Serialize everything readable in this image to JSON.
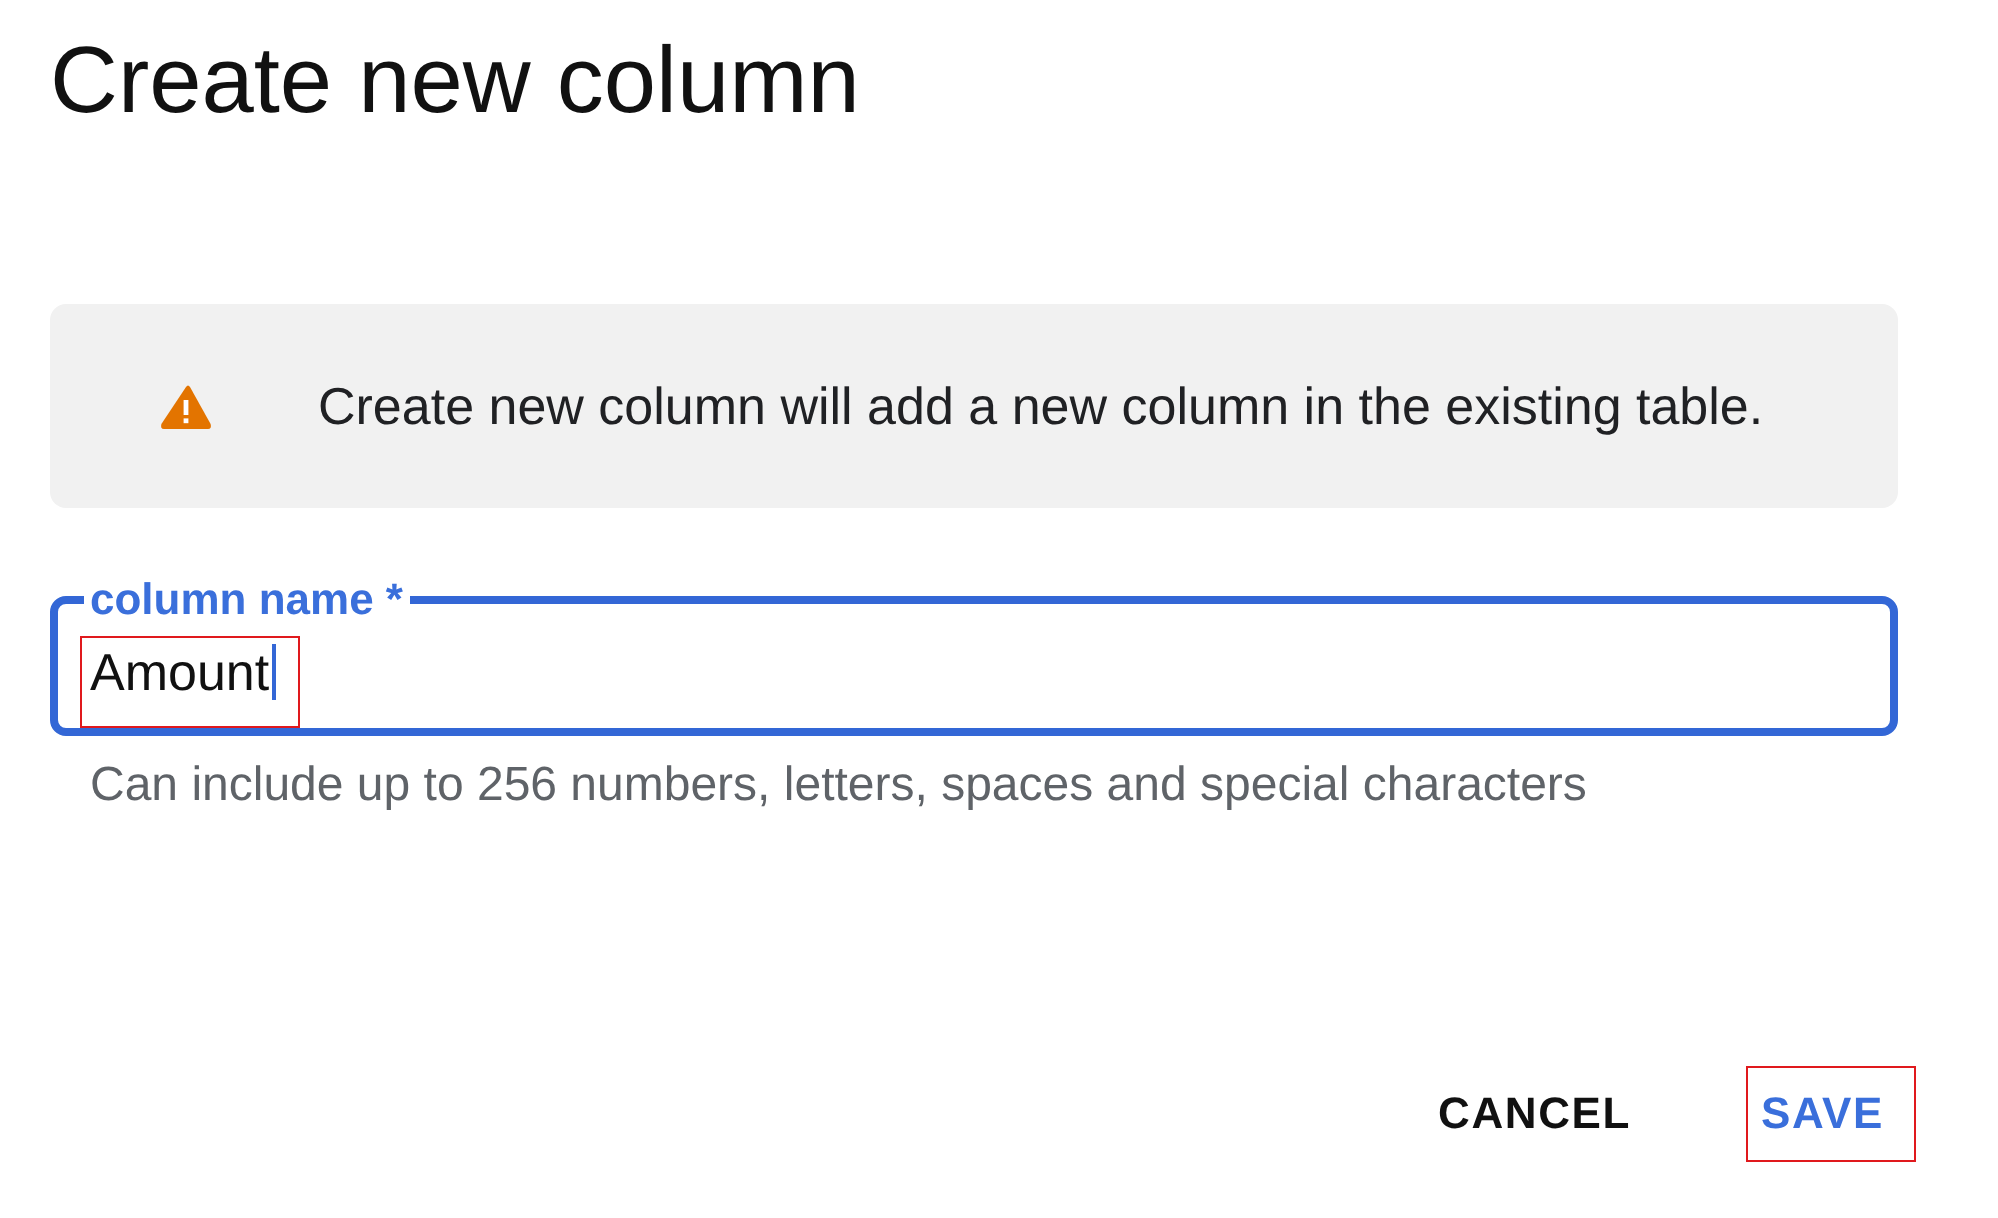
{
  "dialog": {
    "title": "Create new column",
    "banner": {
      "kind": "warning",
      "text": "Create new column will add a new column in the existing table."
    },
    "field": {
      "label": "column name *",
      "value": "Amount",
      "focused": true,
      "highlighted": true,
      "helper": "Can include up to 256 numbers, letters, spaces and special characters"
    },
    "buttons": [
      {
        "label": "CANCEL",
        "primary": false,
        "highlighted": false
      },
      {
        "label": "SAVE",
        "primary": true,
        "highlighted": true
      }
    ]
  }
}
